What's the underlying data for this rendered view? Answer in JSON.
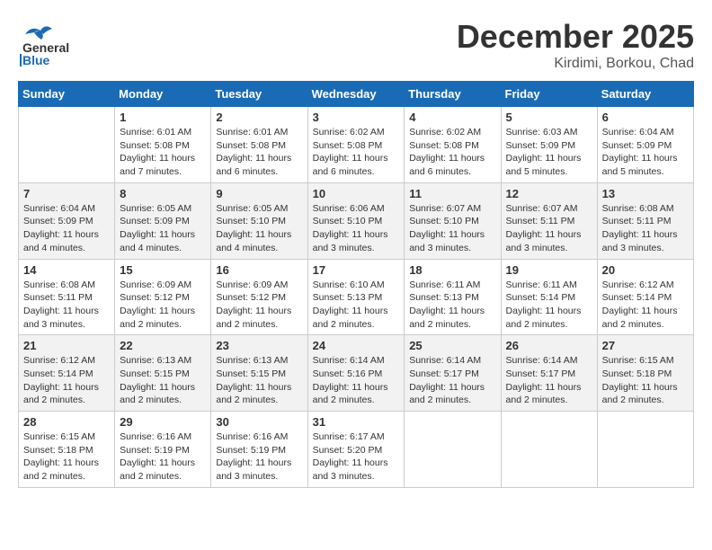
{
  "header": {
    "logo_line1": "General",
    "logo_line2": "Blue",
    "month": "December 2025",
    "location": "Kirdimi, Borkou, Chad"
  },
  "columns": [
    "Sunday",
    "Monday",
    "Tuesday",
    "Wednesday",
    "Thursday",
    "Friday",
    "Saturday"
  ],
  "weeks": [
    [
      {
        "day": "",
        "info": ""
      },
      {
        "day": "1",
        "info": "Sunrise: 6:01 AM\nSunset: 5:08 PM\nDaylight: 11 hours\nand 7 minutes."
      },
      {
        "day": "2",
        "info": "Sunrise: 6:01 AM\nSunset: 5:08 PM\nDaylight: 11 hours\nand 6 minutes."
      },
      {
        "day": "3",
        "info": "Sunrise: 6:02 AM\nSunset: 5:08 PM\nDaylight: 11 hours\nand 6 minutes."
      },
      {
        "day": "4",
        "info": "Sunrise: 6:02 AM\nSunset: 5:08 PM\nDaylight: 11 hours\nand 6 minutes."
      },
      {
        "day": "5",
        "info": "Sunrise: 6:03 AM\nSunset: 5:09 PM\nDaylight: 11 hours\nand 5 minutes."
      },
      {
        "day": "6",
        "info": "Sunrise: 6:04 AM\nSunset: 5:09 PM\nDaylight: 11 hours\nand 5 minutes."
      }
    ],
    [
      {
        "day": "7",
        "info": "Sunrise: 6:04 AM\nSunset: 5:09 PM\nDaylight: 11 hours\nand 4 minutes."
      },
      {
        "day": "8",
        "info": "Sunrise: 6:05 AM\nSunset: 5:09 PM\nDaylight: 11 hours\nand 4 minutes."
      },
      {
        "day": "9",
        "info": "Sunrise: 6:05 AM\nSunset: 5:10 PM\nDaylight: 11 hours\nand 4 minutes."
      },
      {
        "day": "10",
        "info": "Sunrise: 6:06 AM\nSunset: 5:10 PM\nDaylight: 11 hours\nand 3 minutes."
      },
      {
        "day": "11",
        "info": "Sunrise: 6:07 AM\nSunset: 5:10 PM\nDaylight: 11 hours\nand 3 minutes."
      },
      {
        "day": "12",
        "info": "Sunrise: 6:07 AM\nSunset: 5:11 PM\nDaylight: 11 hours\nand 3 minutes."
      },
      {
        "day": "13",
        "info": "Sunrise: 6:08 AM\nSunset: 5:11 PM\nDaylight: 11 hours\nand 3 minutes."
      }
    ],
    [
      {
        "day": "14",
        "info": "Sunrise: 6:08 AM\nSunset: 5:11 PM\nDaylight: 11 hours\nand 3 minutes."
      },
      {
        "day": "15",
        "info": "Sunrise: 6:09 AM\nSunset: 5:12 PM\nDaylight: 11 hours\nand 2 minutes."
      },
      {
        "day": "16",
        "info": "Sunrise: 6:09 AM\nSunset: 5:12 PM\nDaylight: 11 hours\nand 2 minutes."
      },
      {
        "day": "17",
        "info": "Sunrise: 6:10 AM\nSunset: 5:13 PM\nDaylight: 11 hours\nand 2 minutes."
      },
      {
        "day": "18",
        "info": "Sunrise: 6:11 AM\nSunset: 5:13 PM\nDaylight: 11 hours\nand 2 minutes."
      },
      {
        "day": "19",
        "info": "Sunrise: 6:11 AM\nSunset: 5:14 PM\nDaylight: 11 hours\nand 2 minutes."
      },
      {
        "day": "20",
        "info": "Sunrise: 6:12 AM\nSunset: 5:14 PM\nDaylight: 11 hours\nand 2 minutes."
      }
    ],
    [
      {
        "day": "21",
        "info": "Sunrise: 6:12 AM\nSunset: 5:14 PM\nDaylight: 11 hours\nand 2 minutes."
      },
      {
        "day": "22",
        "info": "Sunrise: 6:13 AM\nSunset: 5:15 PM\nDaylight: 11 hours\nand 2 minutes."
      },
      {
        "day": "23",
        "info": "Sunrise: 6:13 AM\nSunset: 5:15 PM\nDaylight: 11 hours\nand 2 minutes."
      },
      {
        "day": "24",
        "info": "Sunrise: 6:14 AM\nSunset: 5:16 PM\nDaylight: 11 hours\nand 2 minutes."
      },
      {
        "day": "25",
        "info": "Sunrise: 6:14 AM\nSunset: 5:17 PM\nDaylight: 11 hours\nand 2 minutes."
      },
      {
        "day": "26",
        "info": "Sunrise: 6:14 AM\nSunset: 5:17 PM\nDaylight: 11 hours\nand 2 minutes."
      },
      {
        "day": "27",
        "info": "Sunrise: 6:15 AM\nSunset: 5:18 PM\nDaylight: 11 hours\nand 2 minutes."
      }
    ],
    [
      {
        "day": "28",
        "info": "Sunrise: 6:15 AM\nSunset: 5:18 PM\nDaylight: 11 hours\nand 2 minutes."
      },
      {
        "day": "29",
        "info": "Sunrise: 6:16 AM\nSunset: 5:19 PM\nDaylight: 11 hours\nand 2 minutes."
      },
      {
        "day": "30",
        "info": "Sunrise: 6:16 AM\nSunset: 5:19 PM\nDaylight: 11 hours\nand 3 minutes."
      },
      {
        "day": "31",
        "info": "Sunrise: 6:17 AM\nSunset: 5:20 PM\nDaylight: 11 hours\nand 3 minutes."
      },
      {
        "day": "",
        "info": ""
      },
      {
        "day": "",
        "info": ""
      },
      {
        "day": "",
        "info": ""
      }
    ]
  ]
}
